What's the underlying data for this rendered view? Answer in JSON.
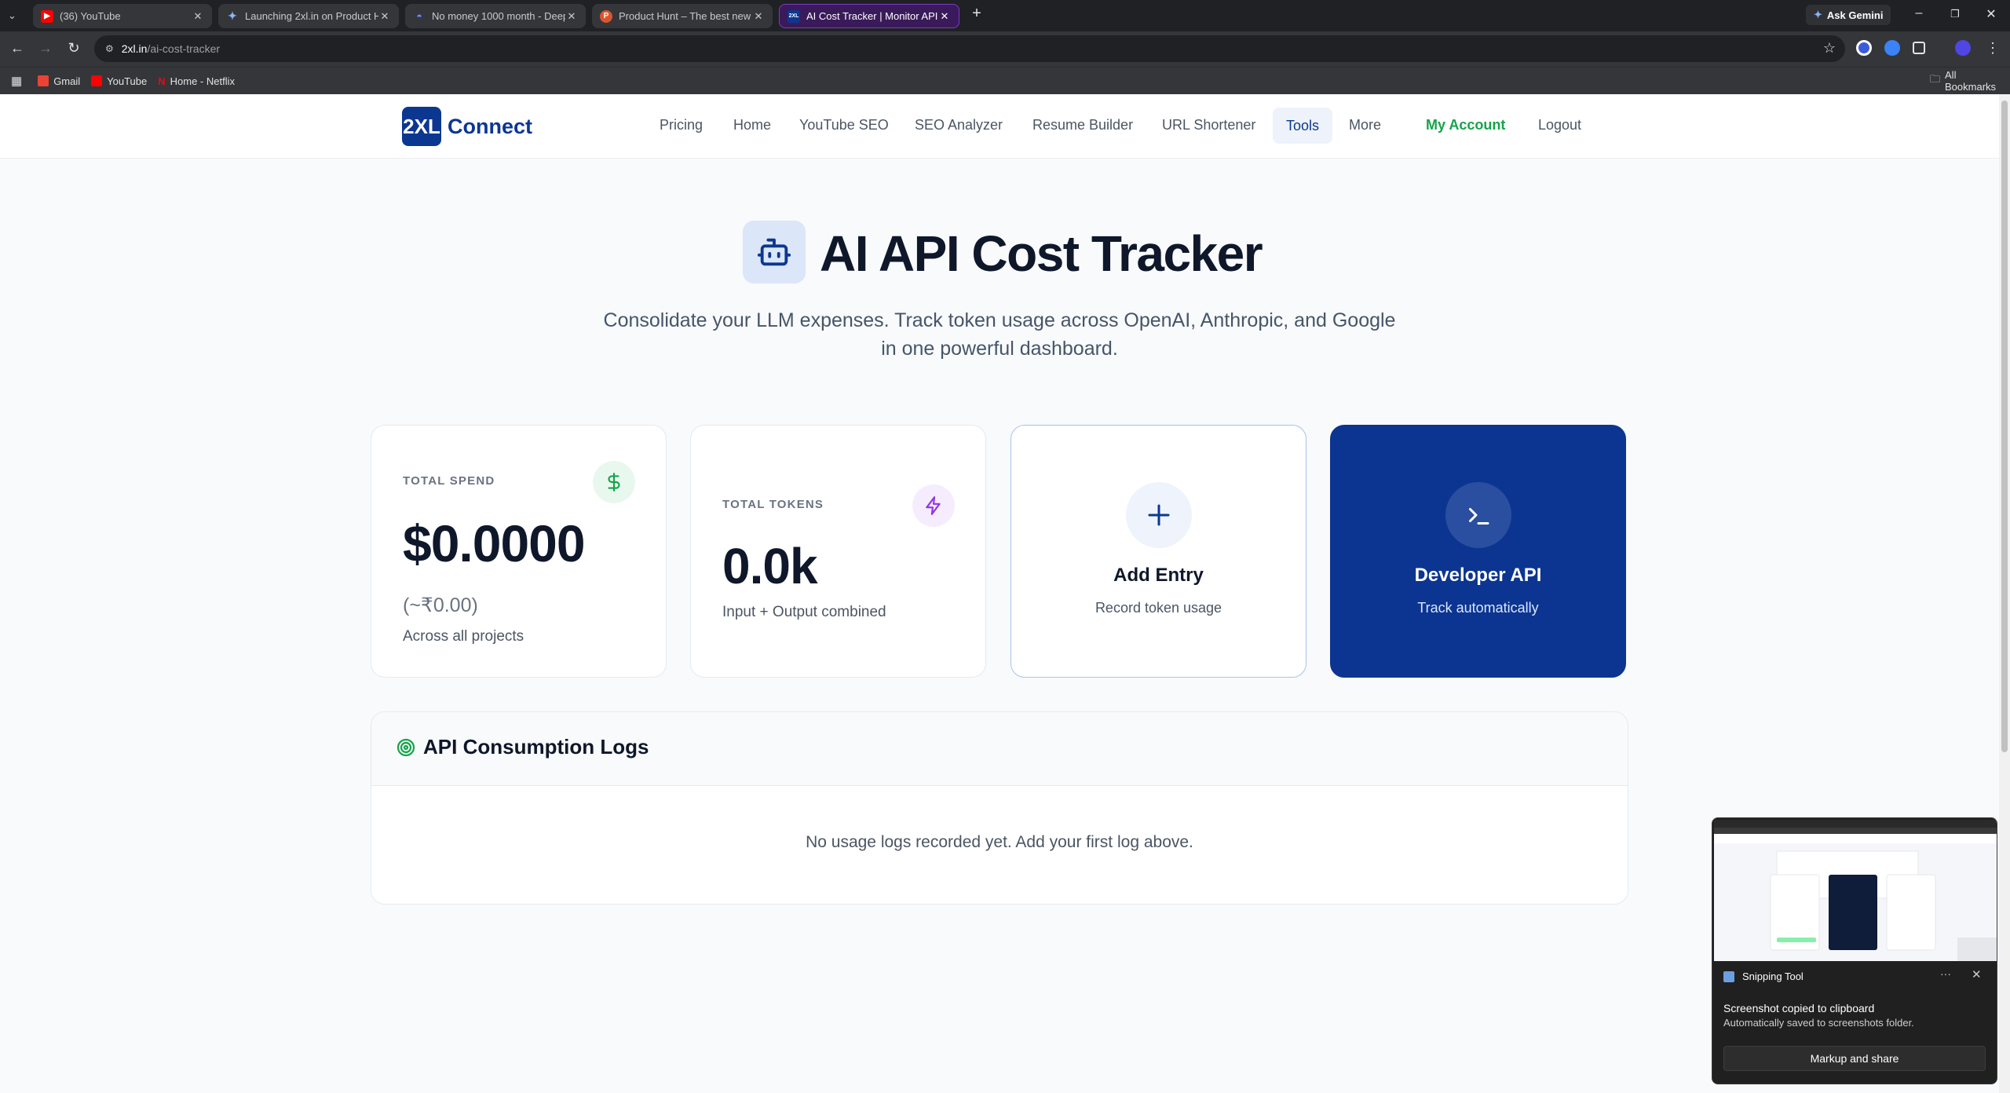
{
  "browser": {
    "tabs": [
      {
        "label": "(36) YouTube",
        "icon": "youtube-icon",
        "color": "#ff0000"
      },
      {
        "label": "Launching 2xl.in on Product Hu",
        "icon": "gemini-icon",
        "color": "#4285f4"
      },
      {
        "label": "No money 1000 month - Deep",
        "icon": "deepseek-icon",
        "color": "#4d6bfe"
      },
      {
        "label": "Product Hunt – The best new p",
        "icon": "producthunt-icon",
        "color": "#da552f"
      },
      {
        "label": "AI Cost Tracker | Monitor API U",
        "icon": "2xl-icon",
        "color": "#0c3791"
      }
    ],
    "ask_gemini": "Ask Gemini",
    "url_host": "2xl.in",
    "url_path": "/ai-cost-tracker",
    "bookmarks": [
      "Gmail",
      "YouTube",
      "Home - Netflix"
    ],
    "all_bookmarks": "All Bookmarks"
  },
  "site": {
    "logo_mark": "2XL",
    "logo_text": "Connect",
    "nav": [
      "Pricing",
      "Home",
      "YouTube SEO",
      "SEO Analyzer",
      "Resume Builder",
      "URL Shortener",
      "Tools",
      "More"
    ],
    "my_account": "My Account",
    "logout": "Logout"
  },
  "hero": {
    "title": "AI API Cost Tracker",
    "subtitle": "Consolidate your LLM expenses. Track token usage across OpenAI, Anthropic, and Google in one powerful dashboard."
  },
  "cards": {
    "spend": {
      "label": "TOTAL SPEND",
      "value": "$0.0000",
      "converted": "(~₹0.00)",
      "note": "Across all projects"
    },
    "tokens": {
      "label": "TOTAL TOKENS",
      "value": "0.0k",
      "note": "Input + Output combined"
    },
    "add": {
      "title": "Add Entry",
      "subtitle": "Record token usage"
    },
    "api": {
      "title": "Developer API",
      "subtitle": "Track automatically"
    }
  },
  "logs": {
    "title": "API Consumption Logs",
    "empty": "No usage logs recorded yet. Add your first log above."
  },
  "toast": {
    "app": "Snipping Tool",
    "message": "Screenshot copied to clipboard",
    "submessage": "Automatically saved to screenshots folder.",
    "button": "Markup and share"
  },
  "colors": {
    "brand": "#0c3791",
    "accent_green": "#16a34a",
    "accent_purple": "#9333ea"
  }
}
